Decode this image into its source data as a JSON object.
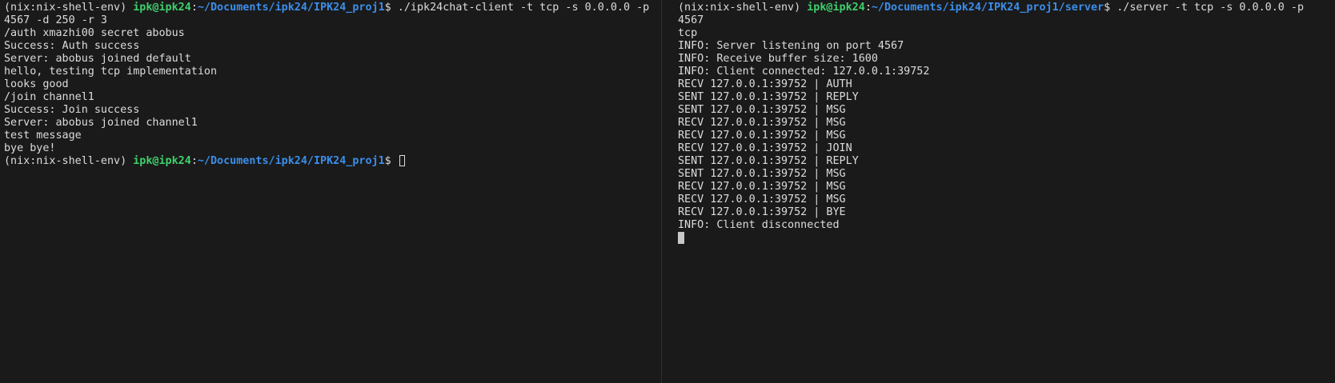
{
  "left_terminal": {
    "prompt": {
      "env": "(nix:nix-shell-env) ",
      "user": "ipk@ipk24",
      "colon": ":",
      "path": "~/Documents/ipk24/IPK24_proj1",
      "symbol": "$ "
    },
    "command_part1": "./ipk24chat-client -t tcp -s 0.0.0.0 -p",
    "command_part2": "4567 -d 250 -r 3",
    "output": [
      "/auth xmazhi00 secret abobus",
      "Success: Auth success",
      "Server: abobus joined default",
      "hello, testing tcp implementation",
      "looks good",
      "/join channel1",
      "Success: Join success",
      "Server: abobus joined channel1",
      "test message",
      "bye bye!"
    ]
  },
  "right_terminal": {
    "prompt": {
      "env": "(nix:nix-shell-env) ",
      "user": "ipk@ipk24",
      "colon": ":",
      "path": "~/Documents/ipk24/IPK24_proj1/server",
      "symbol": "$ "
    },
    "command_part1": "./server -t tcp -s 0.0.0.0 -p",
    "command_part2": "4567",
    "output": [
      "tcp",
      "INFO: Server listening on port 4567",
      "INFO: Receive buffer size: 1600",
      "INFO: Client connected: 127.0.0.1:39752",
      "RECV 127.0.0.1:39752 | AUTH",
      "SENT 127.0.0.1:39752 | REPLY",
      "SENT 127.0.0.1:39752 | MSG",
      "RECV 127.0.0.1:39752 | MSG",
      "RECV 127.0.0.1:39752 | MSG",
      "RECV 127.0.0.1:39752 | JOIN",
      "SENT 127.0.0.1:39752 | REPLY",
      "SENT 127.0.0.1:39752 | MSG",
      "RECV 127.0.0.1:39752 | MSG",
      "RECV 127.0.0.1:39752 | MSG",
      "RECV 127.0.0.1:39752 | BYE",
      "INFO: Client disconnected"
    ]
  },
  "colors": {
    "background": "#1a1a1a",
    "text": "#dcdcdc",
    "prompt_user": "#3fcf6d",
    "prompt_path": "#3b8eea"
  }
}
